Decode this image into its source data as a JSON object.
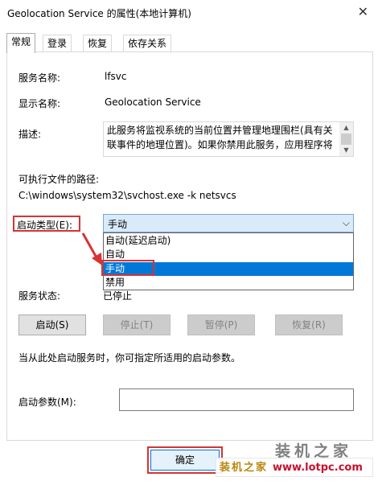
{
  "window": {
    "title": "Geolocation Service 的属性(本地计算机)",
    "close_glyph": "✕"
  },
  "tabs": [
    {
      "label": "常规",
      "active": true
    },
    {
      "label": "登录",
      "active": false
    },
    {
      "label": "恢复",
      "active": false
    },
    {
      "label": "依存关系",
      "active": false
    }
  ],
  "general": {
    "service_name_label": "服务名称:",
    "service_name": "lfsvc",
    "display_name_label": "显示名称:",
    "display_name": "Geolocation Service",
    "description_label": "描述:",
    "description": "此服务将监视系统的当前位置并管理地理围栏(具有关联事件的地理位置)。如果你禁用此服务，应用程序将",
    "exe_path_label": "可执行文件的路径:",
    "exe_path": "C:\\windows\\system32\\svchost.exe -k netsvcs",
    "startup_type_label": "启动类型(E):",
    "startup_type_value": "手动",
    "startup_options": [
      "自动(延迟启动)",
      "自动",
      "手动",
      "禁用"
    ],
    "startup_selected_index": 2,
    "status_label": "服务状态:",
    "status_value": "已停止",
    "buttons": {
      "start": "启动(S)",
      "stop": "停止(T)",
      "pause": "暂停(P)",
      "resume": "恢复(R)"
    },
    "hint": "当从此处启动服务时，你可指定所适用的启动参数。",
    "params_label": "启动参数(M):",
    "params_value": ""
  },
  "footer": {
    "ok": "确定"
  },
  "watermark": {
    "big": "装机之家",
    "brand": "装机之家",
    "site": "www.lotpc.com"
  },
  "colors": {
    "highlight_red": "#d83333",
    "selection_blue": "#0078d7"
  }
}
